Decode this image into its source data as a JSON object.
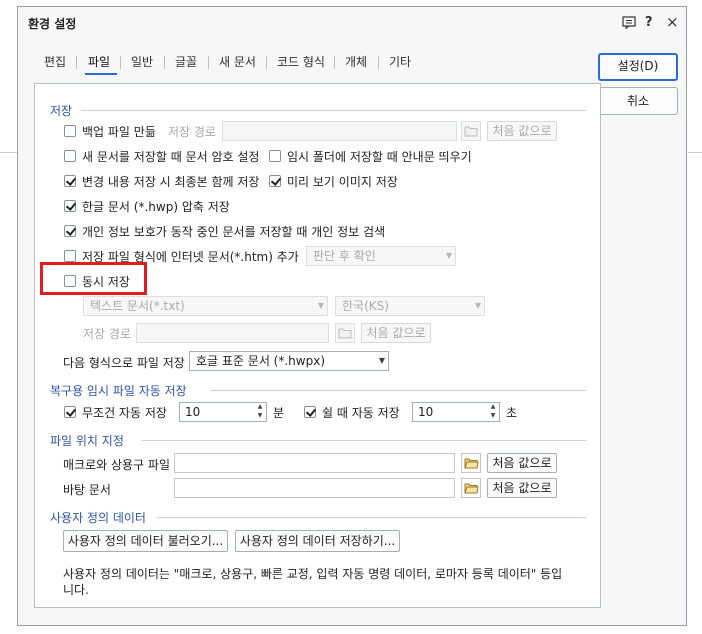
{
  "dialog": {
    "title": "환경 설정",
    "title_icons": [
      "chat-icon",
      "help-icon",
      "close-icon"
    ],
    "help_glyph": "?",
    "close_glyph": "×"
  },
  "tabs": [
    "편집",
    "파일",
    "일반",
    "글꼴",
    "새 문서",
    "코드 형식",
    "개체",
    "기타"
  ],
  "active_tab": "파일",
  "buttons": {
    "ok": "설정(D)",
    "cancel": "취소"
  },
  "save": {
    "section_title": "저장",
    "backup": {
      "label": "백업 파일 만듦",
      "checked": false,
      "path_label": "저장 경로",
      "path_value": "",
      "reset_label": "처음 값으로"
    },
    "password_on_new": {
      "label": "새 문서를 저장할 때 문서 암호 설정",
      "checked": false
    },
    "temp_folder_notice": {
      "label": "임시 폴더에 저장할 때 안내문 띄우기",
      "checked": false
    },
    "save_with_final": {
      "label": "변경 내용 저장 시 최종본 함께 저장",
      "checked": true
    },
    "save_preview": {
      "label": "미리 보기 이미지 저장",
      "checked": true
    },
    "compress_hwp": {
      "label": "한글 문서 (*.hwp) 압축 저장",
      "checked": true
    },
    "privacy_check": {
      "label": "개인 정보 보호가 동작 중인 문서를 저장할 때 개인 정보 검색",
      "checked": true
    },
    "save_htm": {
      "label": "저장 파일 형식에 인터넷 문서(*.htm) 추가",
      "checked": false,
      "combo_value": "판단 후 확인"
    },
    "simultaneous": {
      "label": "동시 저장",
      "checked": false,
      "format_value": "텍스트 문서(*.txt)",
      "encoding_value": "한국(KS)",
      "path_label": "저장 경로",
      "path_value": "",
      "reset_label": "처음 값으로"
    },
    "next_format": {
      "label": "다음 형식으로 파일 저장",
      "value": "호글 표준 문서 (*.hwpx)"
    }
  },
  "autosave": {
    "section_title": "복구용 임시 파일 자동 저장",
    "unconditional": {
      "label": "무조건 자동 저장",
      "checked": true,
      "value": "10",
      "unit": "분"
    },
    "idle": {
      "label": "쉴 때 자동 저장",
      "checked": true,
      "value": "10",
      "unit": "초"
    }
  },
  "file_location": {
    "section_title": "파일 위치 지정",
    "macro": {
      "label": "매크로와 상용구 파일",
      "value": "",
      "reset_label": "처음 값으로"
    },
    "template": {
      "label": "바탕 문서",
      "value": "",
      "reset_label": "처음 값으로"
    }
  },
  "user_data": {
    "section_title": "사용자 정의 데이터",
    "load_button": "사용자 정의 데이터 불러오기...",
    "save_button": "사용자 정의 데이터 저장하기...",
    "description_line1": "사용자 정의 데이터는 \"매크로, 상용구, 빠른 교정, 입력 자동 명령 데이터, 로마자 등록 데이터\" 등입",
    "description_line2": "니다."
  },
  "colors": {
    "accent": "#2b6bd6",
    "section_title": "#2c56a8",
    "highlight_box": "#e21b1b"
  },
  "highlight": {
    "target": "동시 저장"
  }
}
